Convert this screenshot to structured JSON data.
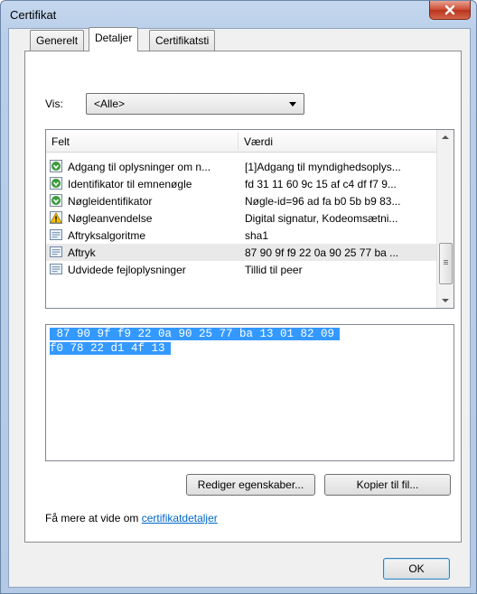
{
  "window": {
    "title": "Certifikat"
  },
  "tabs": [
    {
      "label": "Generelt"
    },
    {
      "label": "Detaljer"
    },
    {
      "label": "Certifikatsti"
    }
  ],
  "filter": {
    "label": "Vis:",
    "selected": "<Alle>"
  },
  "list": {
    "columns": [
      "Felt",
      "Værdi"
    ],
    "rows": [
      {
        "field": "Adgang til oplysninger om n...",
        "value": "[1]Adgang til myndighedsoplys...",
        "icon": "extension-down-icon"
      },
      {
        "field": "Identifikator til emnenøgle",
        "value": "fd 31 11 60 9c 15 af c4 df f7 9...",
        "icon": "extension-down-icon"
      },
      {
        "field": "Nøgleidentifikator",
        "value": "Nøgle-id=96 ad fa b0 5b b9 83...",
        "icon": "extension-down-icon"
      },
      {
        "field": "Nøgleanvendelse",
        "value": "Digital signatur, Kodeomsætni...",
        "icon": "warning-icon"
      },
      {
        "field": "Aftryksalgoritme",
        "value": "sha1",
        "icon": "property-icon"
      },
      {
        "field": "Aftryk",
        "value": "87 90 9f f9 22 0a 90 25 77 ba ...",
        "icon": "property-icon",
        "selected": true
      },
      {
        "field": "Udvidede fejloplysninger",
        "value": "Tillid til peer",
        "icon": "property-icon"
      }
    ]
  },
  "detail": {
    "line1": " 87 90 9f f9 22 0a 90 25 77 ba 13 01 82 09",
    "line2": "f0 78 22 d1 4f 13"
  },
  "buttons": {
    "edit": "Rediger egenskaber...",
    "copy": "Kopier til fil...",
    "ok": "OK"
  },
  "learn_more": {
    "prefix": "Få mere at vide om ",
    "link": "certifikatdetaljer"
  },
  "colors": {
    "selection": "#3399ff",
    "link": "#0066cc",
    "close": "#c94a30"
  }
}
